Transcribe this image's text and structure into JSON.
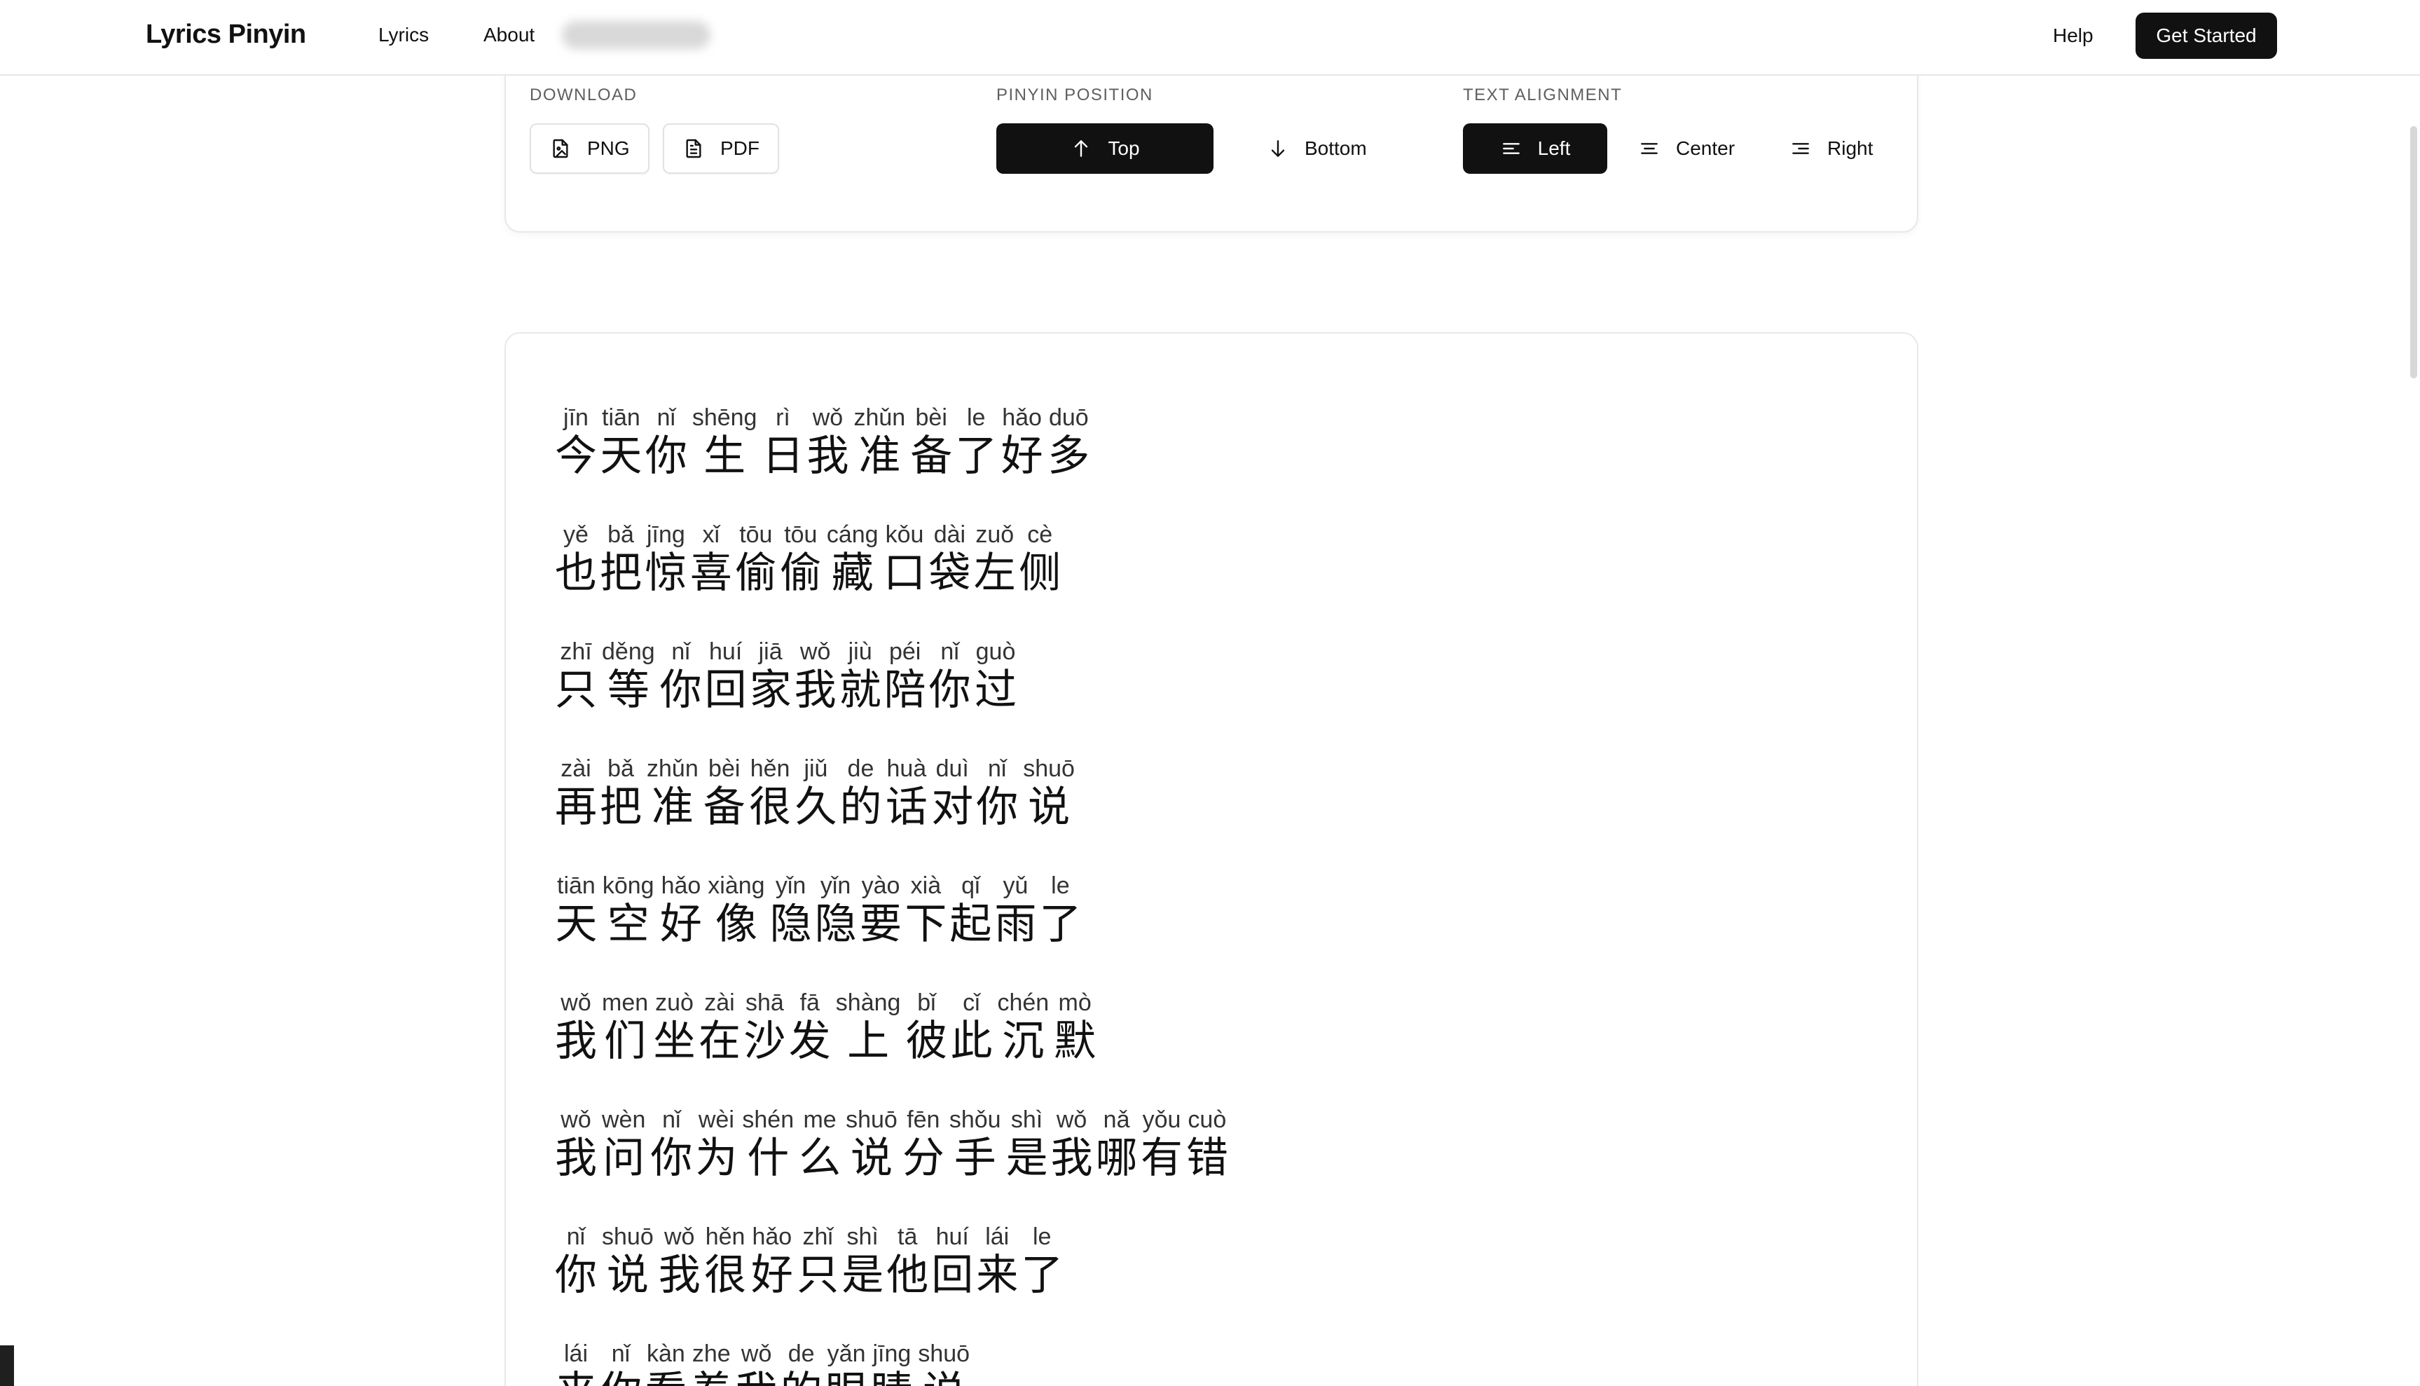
{
  "nav": {
    "brand": "Lyrics Pinyin",
    "links": [
      "Lyrics",
      "About"
    ],
    "help": "Help",
    "cta": "Get Started"
  },
  "settings": {
    "download": {
      "label": "DOWNLOAD",
      "png": "PNG",
      "pdf": "PDF"
    },
    "pinyin_position": {
      "label": "PINYIN POSITION",
      "top": "Top",
      "bottom": "Bottom",
      "selected": "Top"
    },
    "text_alignment": {
      "label": "TEXT ALIGNMENT",
      "left": "Left",
      "center": "Center",
      "right": "Right",
      "selected": "Left"
    }
  },
  "colors": {
    "primary": "#111111",
    "border": "#e8e8e8",
    "muted_text": "#5f5f5f"
  },
  "lyrics": [
    {
      "pinyin": [
        "jīn",
        "tiān",
        "nǐ",
        "shēng",
        "rì",
        "wǒ",
        "zhǔn",
        "bèi",
        "le",
        "hǎo",
        "duō"
      ],
      "hanzi": [
        "今",
        "天",
        "你",
        "生",
        "日",
        "我",
        "准",
        "备",
        "了",
        "好",
        "多"
      ]
    },
    {
      "pinyin": [
        "yě",
        "bǎ",
        "jīng",
        "xǐ",
        "tōu",
        "tōu",
        "cáng",
        "kǒu",
        "dài",
        "zuǒ",
        "cè"
      ],
      "hanzi": [
        "也",
        "把",
        "惊",
        "喜",
        "偷",
        "偷",
        "藏",
        "口",
        "袋",
        "左",
        "侧"
      ]
    },
    {
      "pinyin": [
        "zhī",
        "děng",
        "nǐ",
        "huí",
        "jiā",
        "wǒ",
        "jiù",
        "péi",
        "nǐ",
        "guò"
      ],
      "hanzi": [
        "只",
        "等",
        "你",
        "回",
        "家",
        "我",
        "就",
        "陪",
        "你",
        "过"
      ]
    },
    {
      "pinyin": [
        "zài",
        "bǎ",
        "zhǔn",
        "bèi",
        "hěn",
        "jiǔ",
        "de",
        "huà",
        "duì",
        "nǐ",
        "shuō"
      ],
      "hanzi": [
        "再",
        "把",
        "准",
        "备",
        "很",
        "久",
        "的",
        "话",
        "对",
        "你",
        "说"
      ]
    },
    {
      "pinyin": [
        "tiān",
        "kōng",
        "hǎo",
        "xiàng",
        "yǐn",
        "yǐn",
        "yào",
        "xià",
        "qǐ",
        "yǔ",
        "le"
      ],
      "hanzi": [
        "天",
        "空",
        "好",
        "像",
        "隐",
        "隐",
        "要",
        "下",
        "起",
        "雨",
        "了"
      ]
    },
    {
      "pinyin": [
        "wǒ",
        "men",
        "zuò",
        "zài",
        "shā",
        "fā",
        "shàng",
        "bǐ",
        "cǐ",
        "chén",
        "mò"
      ],
      "hanzi": [
        "我",
        "们",
        "坐",
        "在",
        "沙",
        "发",
        "上",
        "彼",
        "此",
        "沉",
        "默"
      ]
    },
    {
      "pinyin": [
        "wǒ",
        "wèn",
        "nǐ",
        "wèi",
        "shén",
        "me",
        "shuō",
        "fēn",
        "shǒu",
        "shì",
        "wǒ",
        "nǎ",
        "yǒu",
        "cuò"
      ],
      "hanzi": [
        "我",
        "问",
        "你",
        "为",
        "什",
        "么",
        "说",
        "分",
        "手",
        "是",
        "我",
        "哪",
        "有",
        "错"
      ]
    },
    {
      "pinyin": [
        "nǐ",
        "shuō",
        "wǒ",
        "hěn",
        "hǎo",
        "zhǐ",
        "shì",
        "tā",
        "huí",
        "lái",
        "le"
      ],
      "hanzi": [
        "你",
        "说",
        "我",
        "很",
        "好",
        "只",
        "是",
        "他",
        "回",
        "来",
        "了"
      ]
    },
    {
      "pinyin": [
        "lái",
        "nǐ",
        "kàn",
        "zhe",
        "wǒ",
        "de",
        "yǎn",
        "jīng",
        "shuō"
      ],
      "hanzi": [
        "来",
        "你",
        "看",
        "着",
        "我",
        "的",
        "眼",
        "睛",
        "说"
      ]
    }
  ]
}
